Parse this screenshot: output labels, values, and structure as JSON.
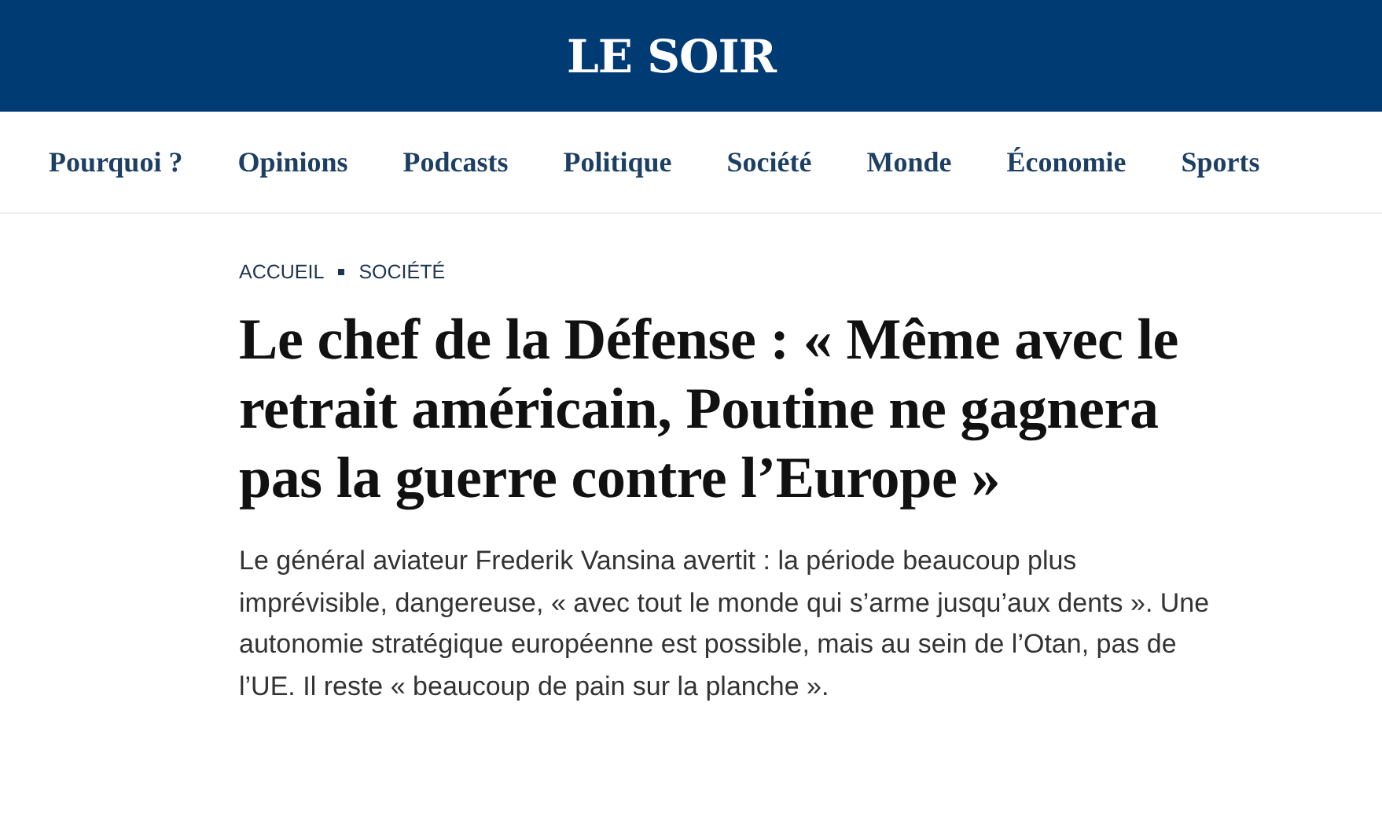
{
  "header": {
    "logo": "LE SOIR"
  },
  "nav": {
    "items": [
      {
        "label": "Pourquoi ?"
      },
      {
        "label": "Opinions"
      },
      {
        "label": "Podcasts"
      },
      {
        "label": "Politique"
      },
      {
        "label": "Société"
      },
      {
        "label": "Monde"
      },
      {
        "label": "Économie"
      },
      {
        "label": "Sports"
      }
    ]
  },
  "breadcrumb": [
    "ACCUEIL",
    "SOCIÉTÉ"
  ],
  "article": {
    "headline": "Le chef de la Défense : « Même avec le retrait américain, Poutine ne gagnera pas la guerre contre l’Europe »",
    "lead": "Le général aviateur Frederik Vansina avertit : la période beaucoup plus imprévisible, dangereuse, « avec tout le monde qui s’arme jusqu’aux dents ». Une autonomie stratégique européenne est possible, mais au sein de l’Otan, pas de l’UE. Il reste « beaucoup de pain sur la planche »."
  }
}
